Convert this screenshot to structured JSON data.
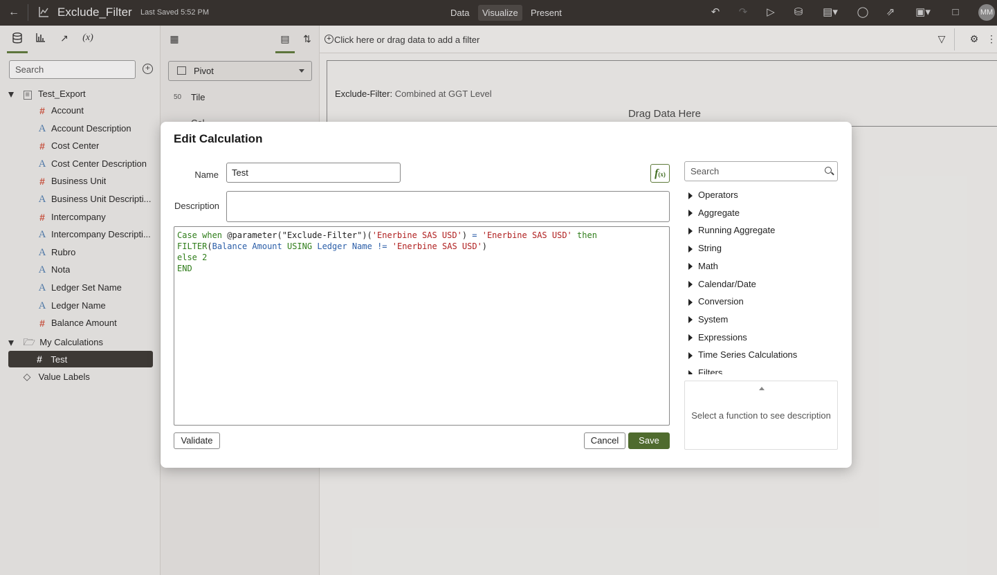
{
  "topbar": {
    "title": "Exclude_Filter",
    "last_saved": "Last Saved 5:52 PM",
    "modes": [
      "Data",
      "Visualize",
      "Present"
    ],
    "active_mode": "Visualize",
    "avatar": "MM"
  },
  "left_panel": {
    "search_placeholder": "Search",
    "dataset": "Test_Export",
    "fields": [
      {
        "label": "Account",
        "type": "number"
      },
      {
        "label": "Account Description",
        "type": "attribute"
      },
      {
        "label": "Cost Center",
        "type": "number"
      },
      {
        "label": "Cost Center Description",
        "type": "attribute"
      },
      {
        "label": "Business Unit",
        "type": "number"
      },
      {
        "label": "Business Unit Descripti...",
        "type": "attribute"
      },
      {
        "label": "Intercompany",
        "type": "number"
      },
      {
        "label": "Intercompany Descripti...",
        "type": "attribute"
      },
      {
        "label": "Rubro",
        "type": "attribute"
      },
      {
        "label": "Nota",
        "type": "attribute"
      },
      {
        "label": "Ledger Set Name",
        "type": "attribute"
      },
      {
        "label": "Ledger Name",
        "type": "attribute"
      },
      {
        "label": "Balance Amount",
        "type": "number"
      }
    ],
    "my_calculations": "My Calculations",
    "calc_item": "Test",
    "value_labels": "Value Labels"
  },
  "middle_panel": {
    "viz_type": "Pivot",
    "tile": "Tile",
    "partial_item": "Col..."
  },
  "canvas": {
    "filter_hint": "Click here or drag data to add a filter",
    "viz_title": "Exclude-Filter:",
    "viz_subtitle": "Combined at GGT Level",
    "drag_text": "Drag Data Here"
  },
  "dialog": {
    "title": "Edit Calculation",
    "name_label": "Name",
    "name_value": "Test",
    "description_label": "Description",
    "description_value": "",
    "fx_label": "f(x)",
    "expression_lines": [
      "Case when @parameter(\"Exclude-Filter\")('Enerbine SAS USD') = 'Enerbine SAS USD' then",
      "FILTER(Balance Amount USING Ledger Name != 'Enerbine SAS USD')",
      "else 2",
      "END"
    ],
    "validate_label": "Validate",
    "cancel_label": "Cancel",
    "save_label": "Save",
    "function_search_placeholder": "Search",
    "function_categories": [
      "Operators",
      "Aggregate",
      "Running Aggregate",
      "String",
      "Math",
      "Calendar/Date",
      "Conversion",
      "System",
      "Expressions",
      "Time Series Calculations",
      "Filters"
    ],
    "function_description": "Select a function to see description"
  }
}
